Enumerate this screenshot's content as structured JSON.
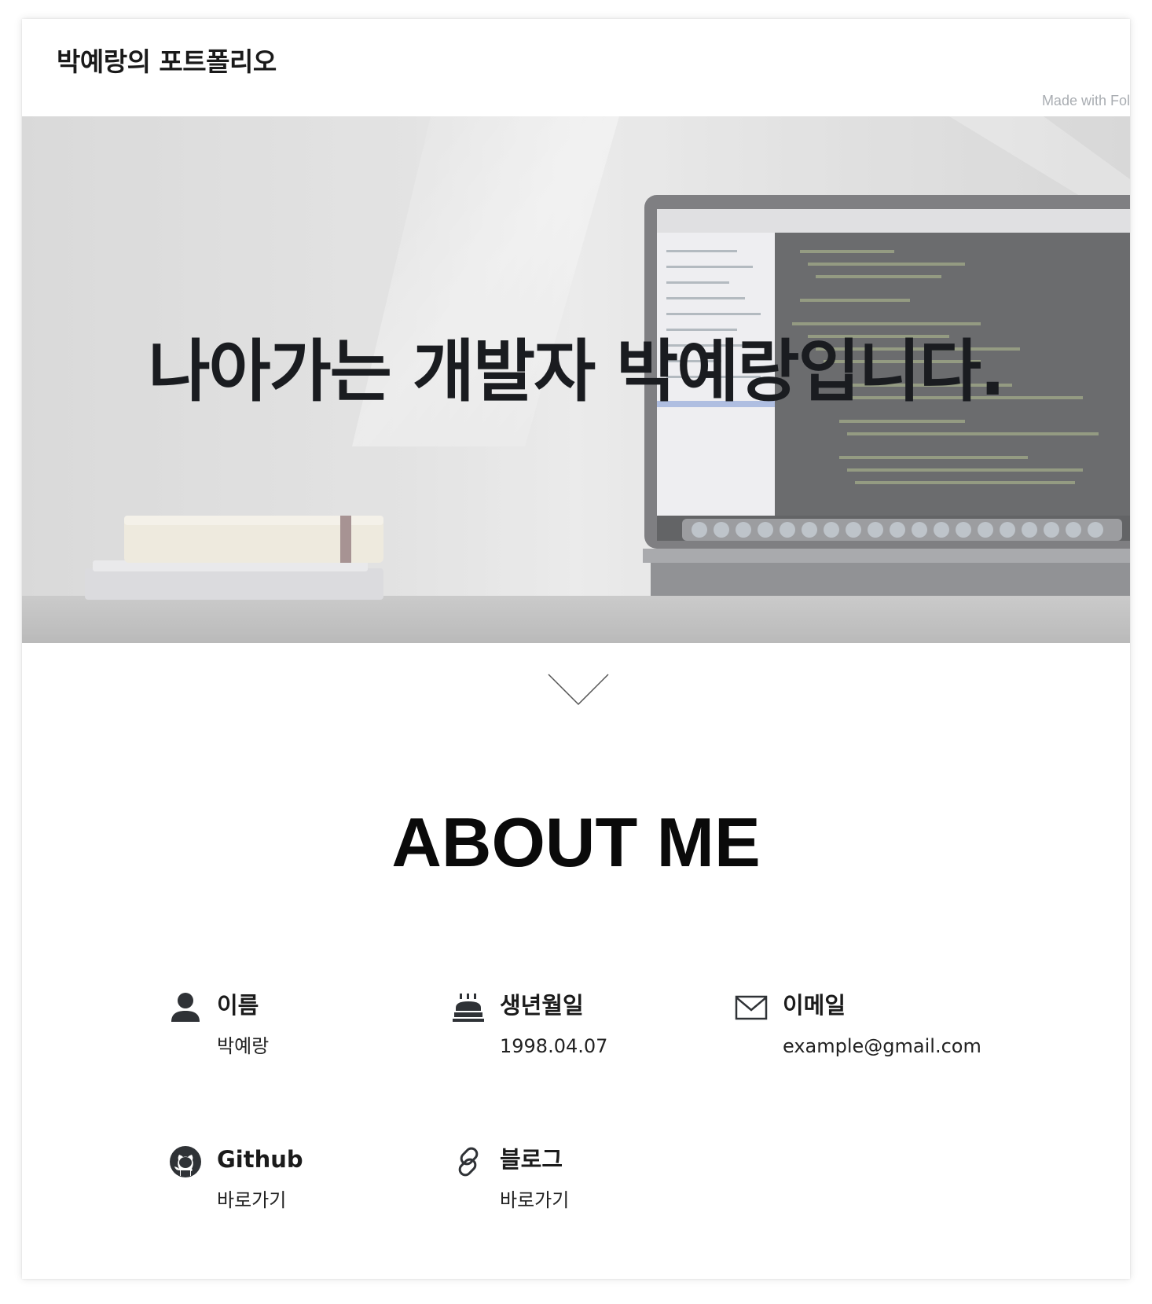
{
  "header": {
    "site_title": "박예랑의 포트폴리오",
    "made_with": "Made with Folio"
  },
  "hero": {
    "heading": "나아가는 개발자 박예랑입니다."
  },
  "about": {
    "title": "ABOUT ME",
    "items": [
      {
        "icon": "person-icon",
        "label": "이름",
        "value": "박예랑"
      },
      {
        "icon": "cake-icon",
        "label": "생년월일",
        "value": "1998.04.07"
      },
      {
        "icon": "mail-icon",
        "label": "이메일",
        "value": "example@gmail.com"
      },
      {
        "icon": "github-icon",
        "label": "Github",
        "value": "바로가기"
      },
      {
        "icon": "link-icon",
        "label": "블로그",
        "value": "바로가기"
      }
    ]
  },
  "colors": {
    "text_dark": "#1a1c20",
    "muted": "#a9adb2",
    "background": "#ffffff"
  }
}
